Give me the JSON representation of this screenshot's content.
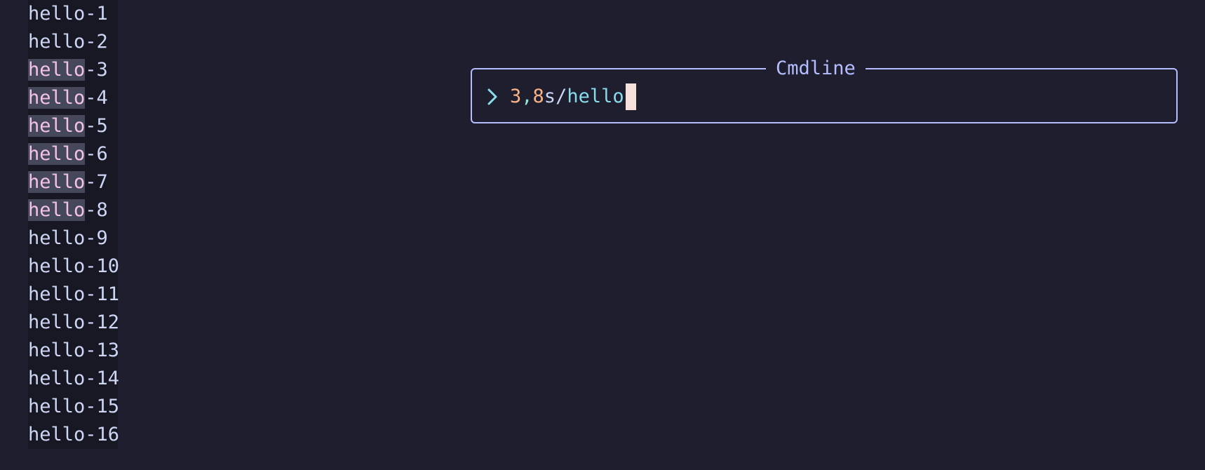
{
  "buffer": {
    "lines": [
      {
        "prefix": "hello",
        "suffix": "-1",
        "highlighted": false
      },
      {
        "prefix": "hello",
        "suffix": "-2",
        "highlighted": false
      },
      {
        "prefix": "hello",
        "suffix": "-3",
        "highlighted": true
      },
      {
        "prefix": "hello",
        "suffix": "-4",
        "highlighted": true
      },
      {
        "prefix": "hello",
        "suffix": "-5",
        "highlighted": true
      },
      {
        "prefix": "hello",
        "suffix": "-6",
        "highlighted": true
      },
      {
        "prefix": "hello",
        "suffix": "-7",
        "highlighted": true
      },
      {
        "prefix": "hello",
        "suffix": "-8",
        "highlighted": true
      },
      {
        "prefix": "hello",
        "suffix": "-9",
        "highlighted": false
      },
      {
        "prefix": "hello",
        "suffix": "-10",
        "highlighted": false
      },
      {
        "prefix": "hello",
        "suffix": "-11",
        "highlighted": false
      },
      {
        "prefix": "hello",
        "suffix": "-12",
        "highlighted": false
      },
      {
        "prefix": "hello",
        "suffix": "-13",
        "highlighted": false
      },
      {
        "prefix": "hello",
        "suffix": "-14",
        "highlighted": false
      },
      {
        "prefix": "hello",
        "suffix": "-15",
        "highlighted": false
      },
      {
        "prefix": "hello",
        "suffix": "-16",
        "highlighted": false
      }
    ]
  },
  "cmdline": {
    "title": "Cmdline",
    "prompt_icon": "chevron-right-icon",
    "range_start": "3",
    "range_sep": ",",
    "range_end": "8",
    "command": "s",
    "slash": "/",
    "pattern": "hello"
  },
  "colors": {
    "background": "#1e1e2e",
    "border": "#b4befe",
    "match_bg": "#45475a",
    "match_fg": "#f5c2e7",
    "number": "#fab387",
    "pattern": "#89dceb",
    "cursor": "#f5e0dc"
  }
}
